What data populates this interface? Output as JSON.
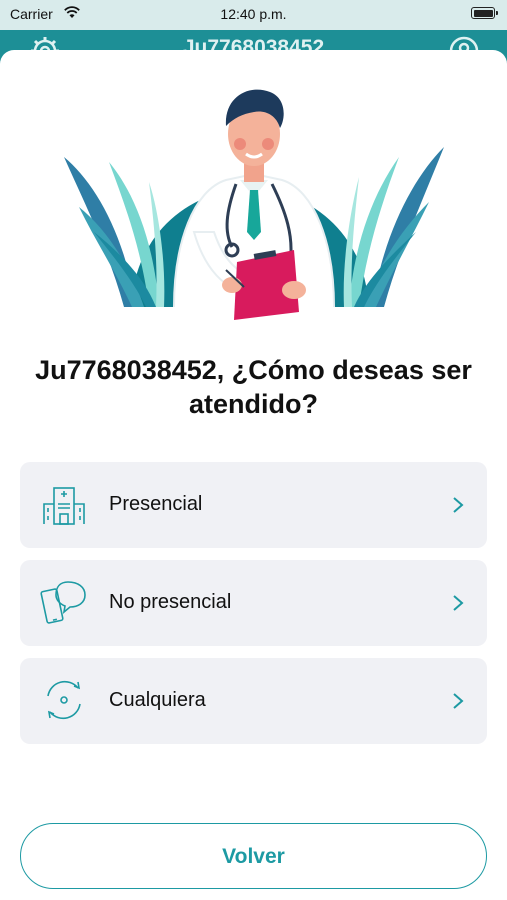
{
  "status_bar": {
    "carrier": "Carrier",
    "time": "12:40 p.m."
  },
  "header": {
    "title": "Ju7768038452",
    "left_icon": "gear-icon",
    "right_icon": "user-icon"
  },
  "sheet": {
    "question": "Ju7768038452, ¿Cómo deseas ser atendido?",
    "options": [
      {
        "label": "Presencial",
        "icon": "hospital-icon"
      },
      {
        "label": "No presencial",
        "icon": "phone-chat-icon"
      },
      {
        "label": "Cualquiera",
        "icon": "cycle-icon"
      }
    ],
    "back_button": "Volver"
  },
  "colors": {
    "accent": "#1d9aa3",
    "header_bg": "#1d8f96",
    "option_bg": "#f0f1f5",
    "clipboard": "#d81b5d"
  }
}
